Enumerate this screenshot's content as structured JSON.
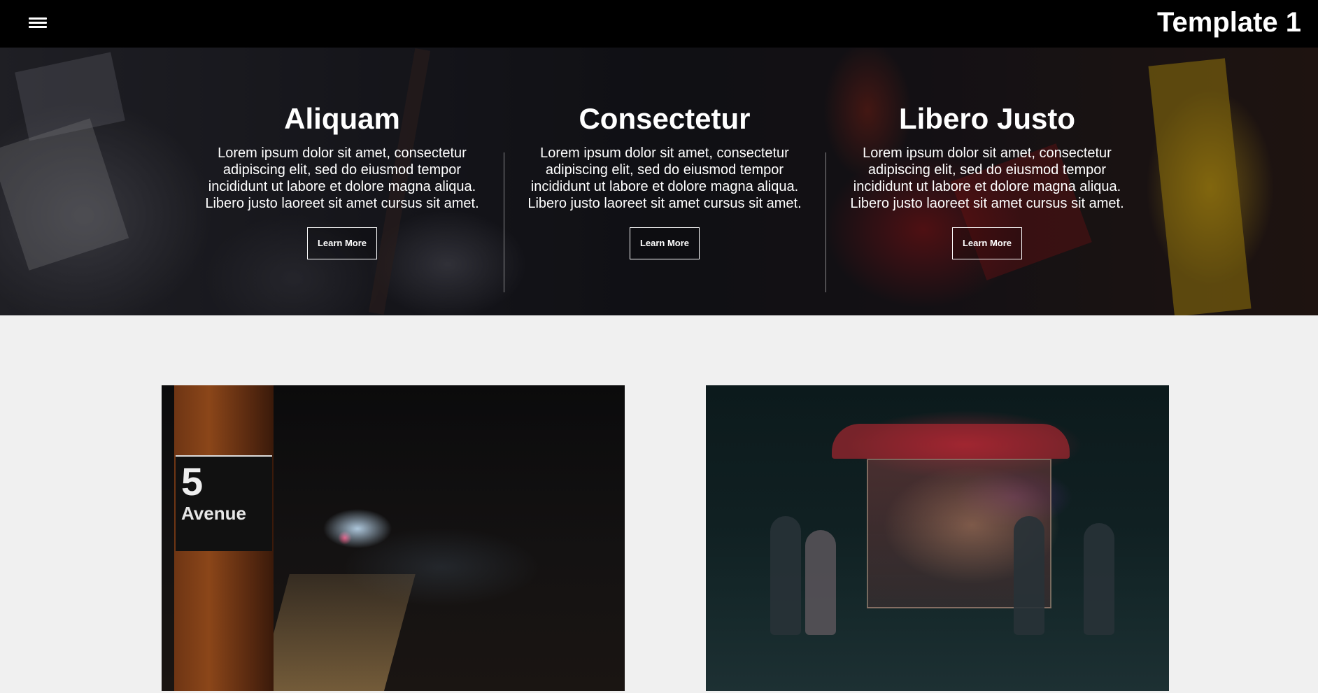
{
  "header": {
    "title": "Template 1",
    "menu_icon": "hamburger-menu-icon"
  },
  "hero": {
    "columns": [
      {
        "heading": "Aliquam",
        "body": "Lorem ipsum dolor sit amet, consectetur adipiscing elit, sed do eiusmod tempor incididunt ut labore et dolore magna aliqua. Libero justo laoreet sit amet cursus sit amet.",
        "button": "Learn More"
      },
      {
        "heading": "Consectetur",
        "body": "Lorem ipsum dolor sit amet, consectetur adipiscing elit, sed do eiusmod tempor incididunt ut labore et dolore magna aliqua. Libero justo laoreet sit amet cursus sit amet.",
        "button": "Learn More"
      },
      {
        "heading": "Libero Justo",
        "body": "Lorem ipsum dolor sit amet, consectetur adipiscing elit, sed do eiusmod tempor incididunt ut labore et dolore magna aliqua. Libero justo laoreet sit amet cursus sit amet.",
        "button": "Learn More"
      }
    ]
  },
  "gallery": {
    "subway_sign": {
      "number": "5",
      "street": "Avenue"
    }
  }
}
